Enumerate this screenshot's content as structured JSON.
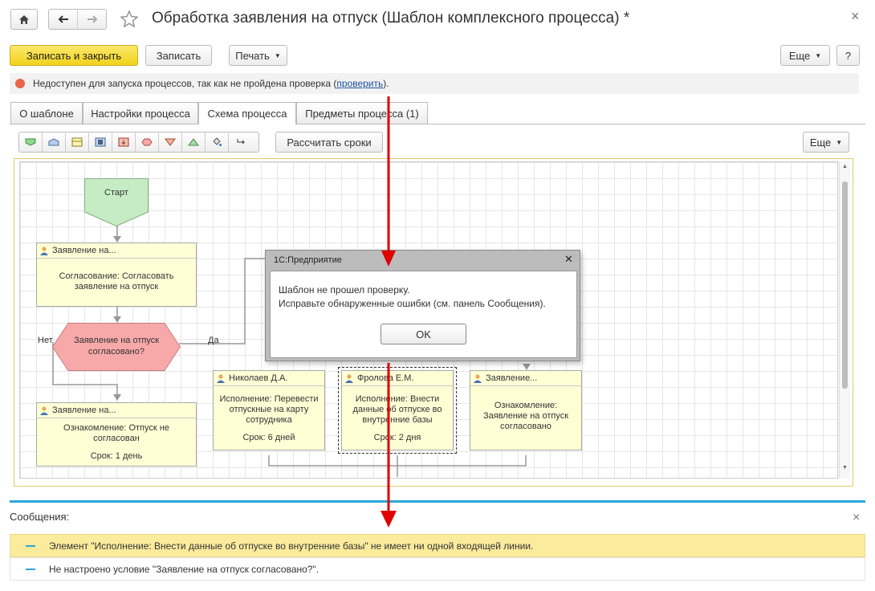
{
  "window": {
    "title": "Обработка заявления на отпуск (Шаблон комплексного процесса) *",
    "close": "×"
  },
  "toolbar": {
    "save_close": "Записать и закрыть",
    "save": "Записать",
    "print": "Печать",
    "more": "Еще",
    "help": "?"
  },
  "warning": {
    "text": "Недоступен для запуска процессов, так как не пройдена проверка (",
    "link": "проверить",
    "tail": ")."
  },
  "tabs": [
    {
      "label": "О шаблоне"
    },
    {
      "label": "Настройки процесса"
    },
    {
      "label": "Схема процесса"
    },
    {
      "label": "Предметы процесса (1)"
    }
  ],
  "scheme_toolbar": {
    "calc": "Рассчитать сроки",
    "more": "Еще"
  },
  "scheme": {
    "start": "Старт",
    "node1": {
      "header": "Заявление на...",
      "line1": "Согласование: Согласовать",
      "line2": "заявление на отпуск"
    },
    "cond": {
      "line1": "Заявление на отпуск",
      "line2": "согласовано?",
      "no": "Нет",
      "yes": "Да"
    },
    "node2": {
      "header": "Заявление на...",
      "line1": "Ознакомление: Отпуск не",
      "line2": "согласован",
      "term": "Срок: 1 день"
    },
    "node3": {
      "header": "Николаев Д.А.",
      "line1": "Исполнение: Перевести",
      "line2": "отпускные на карту",
      "line3": "сотрудника",
      "term": "Срок: 6 дней"
    },
    "node4": {
      "header": "Фролова Е.М.",
      "line1": "Исполнение: Внести",
      "line2": "данные об отпуске во",
      "line3": "внутренние базы",
      "term": "Срок: 2 дня"
    },
    "node5": {
      "header": "Заявление...",
      "line1": "Ознакомление:",
      "line2": "Заявление на отпуск",
      "line3": "согласовано"
    }
  },
  "dialog": {
    "title": "1С:Предприятие",
    "close": "✕",
    "line1": "Шаблон не прошел проверку.",
    "line2": "Исправьте обнаруженные ошибки (см. панель Сообщения).",
    "ok": "OK"
  },
  "messages": {
    "title": "Сообщения:",
    "close": "×",
    "items": [
      {
        "text": "Элемент \"Исполнение: Внести данные об отпуске во внутренние базы\" не имеет ни одной входящей линии."
      },
      {
        "text": "Не настроено условие \"Заявление на отпуск согласовано?\"."
      }
    ]
  },
  "colors": {
    "primary": "#f4d620",
    "start_node": "#c6ecc6",
    "condition": "#f7a9a9",
    "task_node": "#ffffd6",
    "message_highlight": "#fbeb9c",
    "accent_line": "#29a8d9",
    "annotation_arrow": "#e00000"
  }
}
